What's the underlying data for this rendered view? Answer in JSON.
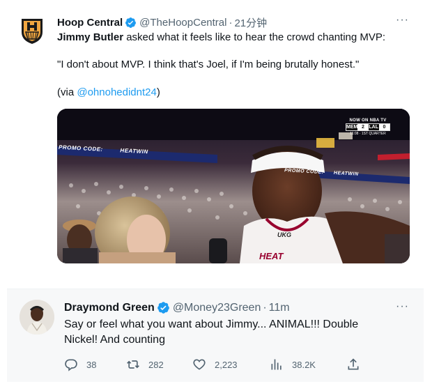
{
  "tweet1": {
    "author_name": "Hoop Central",
    "handle": "@TheHoopCentral",
    "separator": "·",
    "time": "21分钟",
    "more": "···",
    "text_subject": "Jimmy Butler",
    "text_rest": " asked what it feels like to hear the crowd chanting MVP:",
    "quote": "\"I don't about MVP. I think that's Joel, if I'm being brutally honest.\"",
    "via_prefix": "(via ",
    "via_link": "@ohnohedidnt24",
    "via_suffix": ")",
    "media": {
      "now_on": "NOW ON NBA TV",
      "team_a": "MEM",
      "score_a": "2",
      "team_b": "LAL",
      "score_b": "0",
      "quarter": "11:08 · 1ST QUARTER",
      "banner_left": "PROMO CODE:",
      "banner_left2": "HEATWIN",
      "banner_right": "PROMO CODE:",
      "banner_right2": "HEATWIN",
      "jersey_text": "UKG",
      "jersey_team": "HEAT"
    }
  },
  "tweet2": {
    "author_name": "Draymond Green",
    "handle": "@Money23Green",
    "separator": "·",
    "time": "11m",
    "more": "···",
    "text": "Say or feel what you want about Jimmy... ANIMAL!!! Double Nickel! And counting",
    "replies": "38",
    "retweets": "282",
    "likes": "2,223",
    "views": "38.2K"
  },
  "colors": {
    "verified": "#1d9bf0",
    "link": "#1d9bf0",
    "secondary_text": "#536471",
    "heat_red": "#98002e"
  }
}
